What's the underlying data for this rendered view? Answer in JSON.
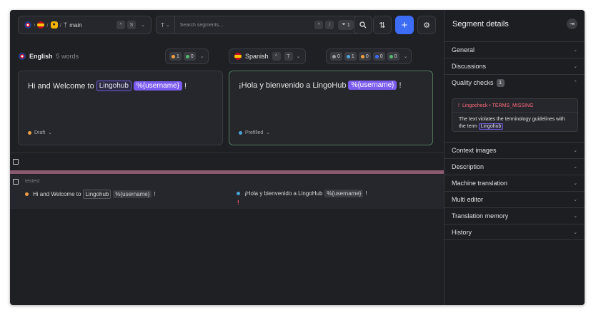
{
  "toolbar": {
    "breadcrumb_sep": "/",
    "branch_name": "main",
    "shortcut_up": "^",
    "shortcut_key": "S",
    "type_label": "T",
    "search_placeholder": "Search segments...",
    "search_shortcut_up": "^",
    "search_shortcut_key": "/",
    "filter_count": "1",
    "icons": {
      "source_flag": "uk-flag-icon",
      "target_flag": "spain-flag-icon",
      "project": "project-icon",
      "branch": "git-branch-icon",
      "clear": "close-icon",
      "search": "search-icon",
      "sort": "sort-icon",
      "add": "plus-icon",
      "settings": "gear-icon"
    }
  },
  "source": {
    "language": "English",
    "word_count": "5 words",
    "counts": [
      "1",
      "0"
    ],
    "text_before": "Hi and Welcome to",
    "term": "Lingohub",
    "placeholder": "%{username}",
    "text_after": "!",
    "status": "Draft"
  },
  "target": {
    "language": "Spanish",
    "shortcut_up": "^",
    "shortcut_key": "T",
    "counts": [
      "0",
      "1",
      "0",
      "0",
      "0"
    ],
    "text_before": "¡Hola y bienvenido a LingoHub",
    "placeholder": "%{username}",
    "text_after": "!",
    "status": "Prefilled"
  },
  "list": {
    "row_key": "testest",
    "source_before": "Hi and Welcome to",
    "source_term": "Lingohub",
    "source_ph": "%{username}",
    "source_after": "!",
    "target_text": "¡Hola y bienvenido a LingoHub",
    "target_ph": "%{username}",
    "target_after": "!",
    "warning_mark": "!"
  },
  "panel": {
    "title": "Segment details",
    "sections": {
      "general": "General",
      "discussions": "Discussions",
      "quality": "Quality checks",
      "quality_count": "1",
      "context_images": "Context images",
      "description": "Description",
      "machine_translation": "Machine translation",
      "multi_editor": "Multi editor",
      "translation_memory": "Translation memory",
      "history": "History"
    },
    "quality_check": {
      "mark": "!",
      "title": "Lingocheck • TERMS_MISSING",
      "message": "The text violates the terminology guidelines with the term",
      "term": "Lingohub"
    }
  },
  "colors": {
    "accent": "#3d6cf5",
    "placeholder": "#7b5cf0",
    "draft": "#f0a040",
    "prefilled": "#4aa3d8",
    "error": "#ff5c6c",
    "row_accent": "#8a5b6e"
  }
}
